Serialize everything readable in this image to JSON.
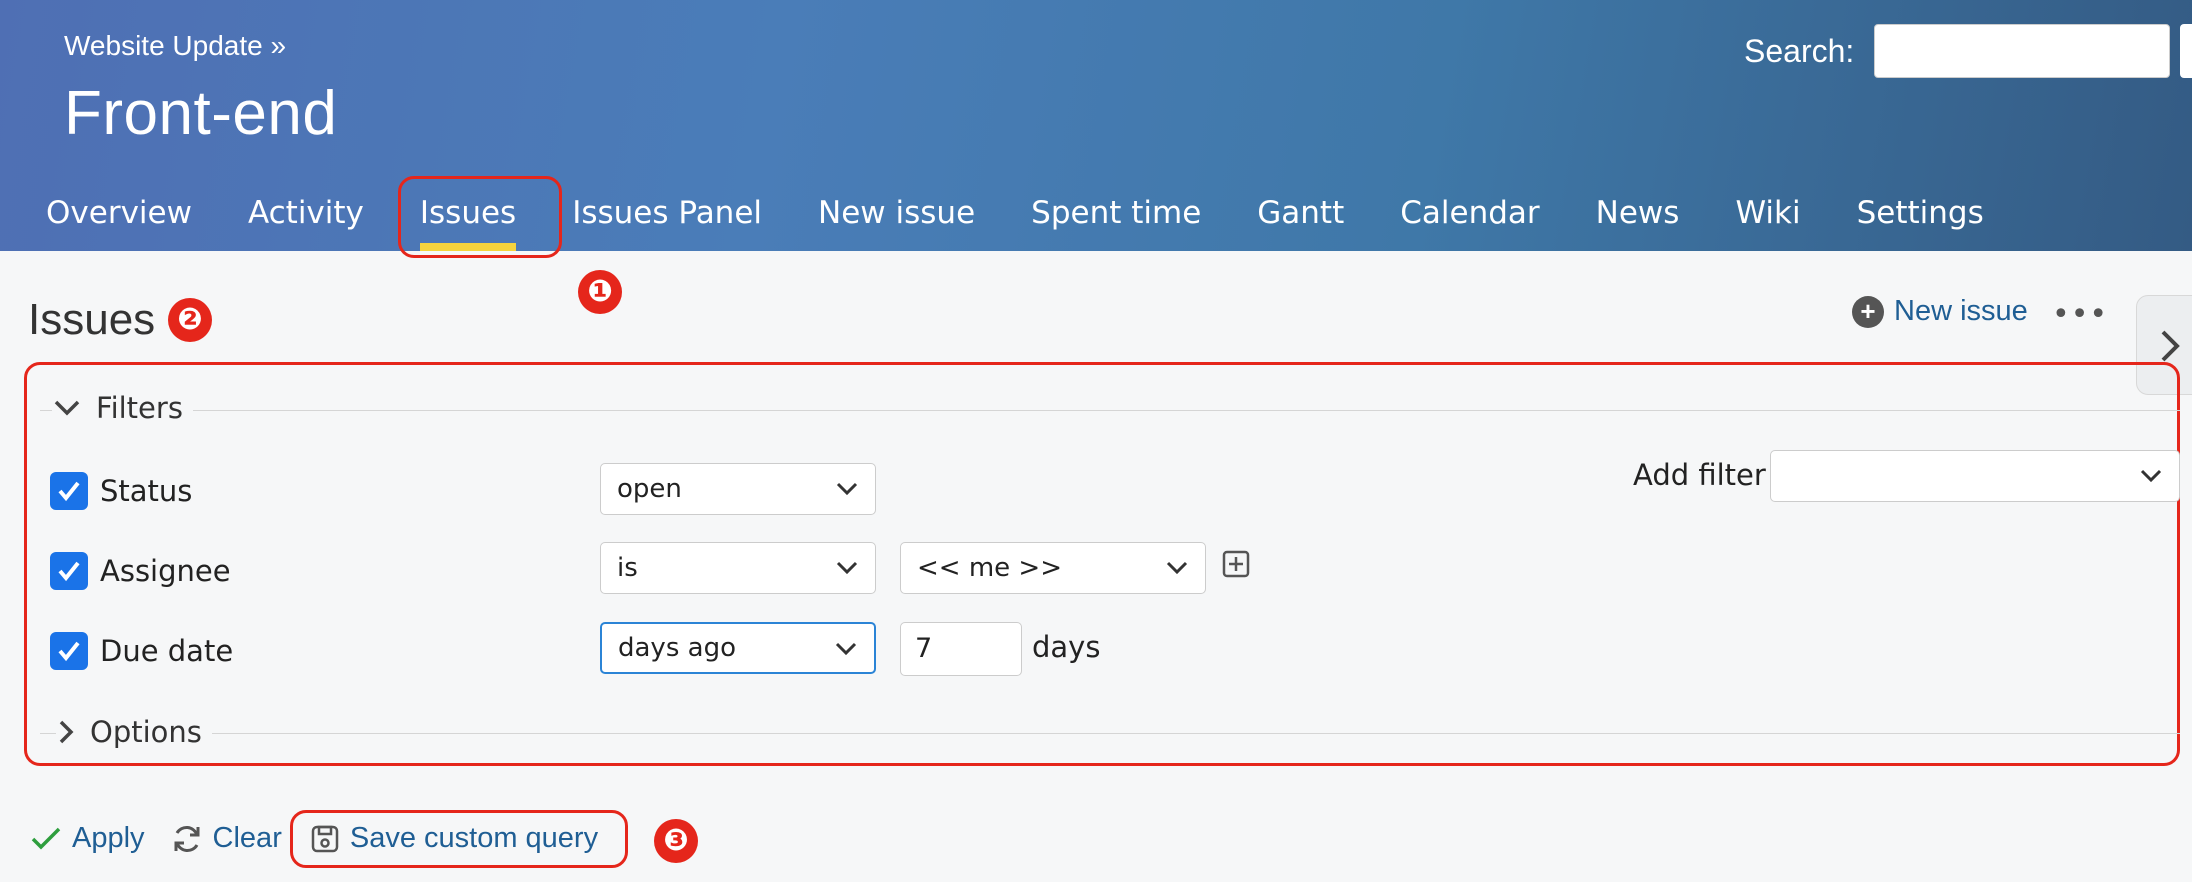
{
  "header": {
    "breadcrumb": "Website Update »",
    "project_title": "Front-end",
    "search_label": "Search:",
    "search_value": ""
  },
  "main_menu": {
    "tabs": [
      {
        "label": "Overview"
      },
      {
        "label": "Activity"
      },
      {
        "label": "Issues",
        "selected": true
      },
      {
        "label": "Issues Panel"
      },
      {
        "label": "New issue"
      },
      {
        "label": "Spent time"
      },
      {
        "label": "Gantt"
      },
      {
        "label": "Calendar"
      },
      {
        "label": "News"
      },
      {
        "label": "Wiki"
      },
      {
        "label": "Settings"
      }
    ]
  },
  "content": {
    "title": "Issues",
    "new_issue_label": "New issue",
    "more_label": "•••"
  },
  "filters": {
    "legend": "Filters",
    "rows": [
      {
        "label": "Status",
        "checked": true,
        "operator": "open"
      },
      {
        "label": "Assignee",
        "checked": true,
        "operator": "is",
        "value": "<< me >>"
      },
      {
        "label": "Due date",
        "checked": true,
        "operator": "days ago",
        "value": "7",
        "suffix": "days"
      }
    ],
    "add_filter_label": "Add filter",
    "add_filter_value": ""
  },
  "options": {
    "legend": "Options"
  },
  "actions": {
    "apply": "Apply",
    "clear": "Clear",
    "save": "Save custom query"
  },
  "annotations": {
    "badges": [
      "❶",
      "❷",
      "❸"
    ],
    "color": "#e5261b"
  },
  "colors": {
    "header_gradient_start": "#4f6fb4",
    "header_gradient_end": "#345b84",
    "selected_tab_underline": "#f5d33d",
    "link": "#1f5e94",
    "checkbox": "#1a73e8",
    "apply_check": "#2e9e3e"
  }
}
